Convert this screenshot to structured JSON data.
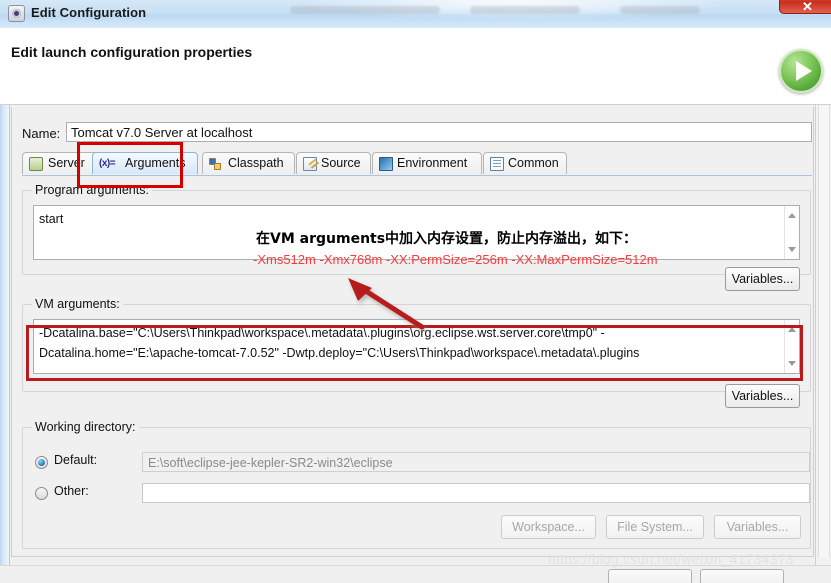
{
  "window": {
    "title": "Edit Configuration",
    "icon": "eclipse-config-icon",
    "close_label": "✕"
  },
  "header": {
    "title": "Edit launch configuration properties",
    "run_icon": "run-play-icon"
  },
  "name_row": {
    "label": "Name:",
    "value": "Tomcat v7.0 Server at localhost"
  },
  "tabs": [
    {
      "label": "Server",
      "icon": "server-icon",
      "active": false
    },
    {
      "label": "Arguments",
      "icon": "arguments-icon",
      "active": true
    },
    {
      "label": "Classpath",
      "icon": "classpath-icon",
      "active": false
    },
    {
      "label": "Source",
      "icon": "source-icon",
      "active": false
    },
    {
      "label": "Environment",
      "icon": "environment-icon",
      "active": false
    },
    {
      "label": "Common",
      "icon": "common-icon",
      "active": false
    }
  ],
  "program_arguments": {
    "group_label": "Program arguments:",
    "value": "start",
    "variables_button": "Variables..."
  },
  "vm_arguments": {
    "group_label": "VM arguments:",
    "line1": "-Dcatalina.base=\"C:\\Users\\Thinkpad\\workspace\\.metadata\\.plugins\\org.eclipse.wst.server.core\\tmp0\" -",
    "line2": "Dcatalina.home=\"E:\\apache-tomcat-7.0.52\" -Dwtp.deploy=\"C:\\Users\\Thinkpad\\workspace\\.metadata\\.plugins",
    "variables_button": "Variables..."
  },
  "working_directory": {
    "group_label": "Working directory:",
    "default_label": "Default:",
    "default_value": "E:\\soft\\eclipse-jee-kepler-SR2-win32\\eclipse",
    "default_selected": true,
    "other_label": "Other:",
    "other_value": "",
    "other_selected": false,
    "workspace_button": "Workspace...",
    "file_system_button": "File System...",
    "variables_button": "Variables..."
  },
  "annotations": {
    "chinese_note": "在VM arguments中加入内存设置，防止内存溢出，如下：",
    "red_flags": "-Xms512m -Xmx768m -XX:PermSize=256m -XX:MaxPermSize=512m",
    "highlight_color": "#d40000",
    "red_text_color": "#fb3b3b",
    "arrow": "red-arrow-pointer"
  },
  "watermark": {
    "text": "https://blog.csdn.net/weixin_41734373"
  }
}
